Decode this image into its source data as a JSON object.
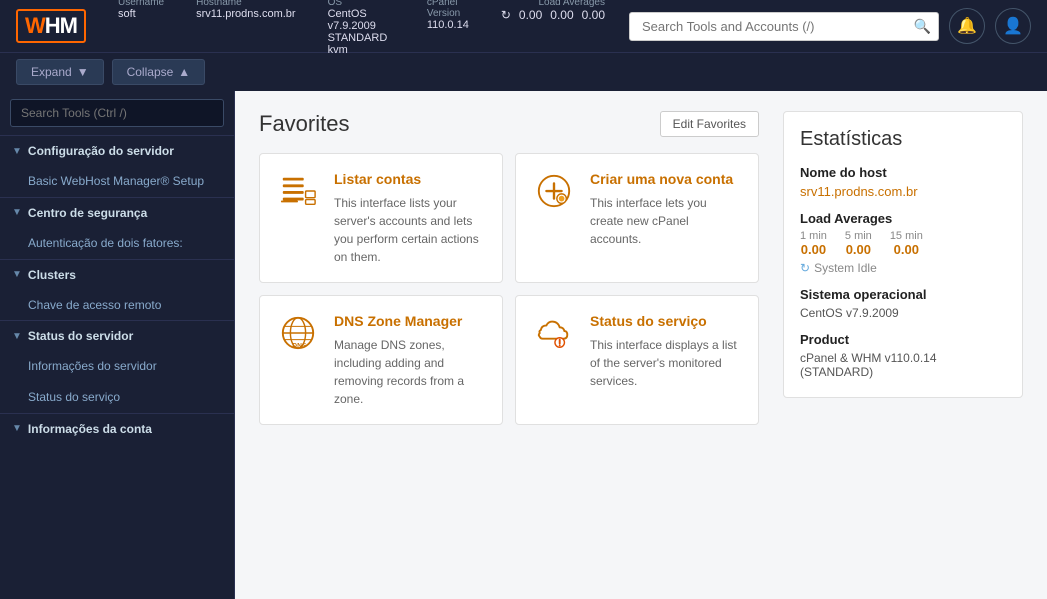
{
  "topbar": {
    "logo": "WHM",
    "username_label": "Username",
    "username_value": "soft",
    "hostname_label": "Hostname",
    "hostname_value": "srv11.prodns.com.br",
    "os_label": "OS",
    "os_value": "CentOS v7.9.2009 STANDARD kvm",
    "cpanel_label": "cPanel Version",
    "cpanel_value": "110.0.14",
    "load_label": "Load Averages",
    "load_values": [
      "0.00",
      "0.00",
      "0.00"
    ],
    "search_placeholder": "Search Tools and Accounts (/)"
  },
  "secondbar": {
    "expand_label": "Expand",
    "collapse_label": "Collapse"
  },
  "sidebar": {
    "search_placeholder": "Search Tools (Ctrl /)",
    "sections": [
      {
        "title": "Configuração do servidor",
        "items": [
          "Basic WebHost Manager® Setup"
        ]
      },
      {
        "title": "Centro de segurança",
        "items": [
          "Autenticação de dois fatores:"
        ]
      },
      {
        "title": "Clusters",
        "items": [
          "Chave de acesso remoto"
        ]
      },
      {
        "title": "Status do servidor",
        "items": [
          "Informações do servidor",
          "Status do serviço"
        ]
      },
      {
        "title": "Informações da conta",
        "items": []
      }
    ]
  },
  "favorites": {
    "title": "Favorites",
    "edit_button": "Edit Favorites",
    "cards": [
      {
        "title": "Listar contas",
        "description": "This interface lists your server's accounts and lets you perform certain actions on them.",
        "icon_type": "list"
      },
      {
        "title": "Criar uma nova conta",
        "description": "This interface lets you create new cPanel accounts.",
        "icon_type": "create"
      },
      {
        "title": "DNS Zone Manager",
        "description": "Manage DNS zones, including adding and removing records from a zone.",
        "icon_type": "dns"
      },
      {
        "title": "Status do serviço",
        "description": "This interface displays a list of the server's monitored services.",
        "icon_type": "cloud"
      }
    ]
  },
  "stats": {
    "title": "Estatísticas",
    "hostname_label": "Nome do host",
    "hostname_value": "srv11.prodns.com.br",
    "load_label": "Load Averages",
    "load_cols": [
      "1 min",
      "5 min",
      "15 min"
    ],
    "load_values": [
      "0.00",
      "0.00",
      "0.00"
    ],
    "system_idle": "System Idle",
    "os_label": "Sistema operacional",
    "os_value": "CentOS v7.9.2009",
    "product_label": "Product",
    "product_value": "cPanel & WHM v110.0.14 (STANDARD)"
  }
}
